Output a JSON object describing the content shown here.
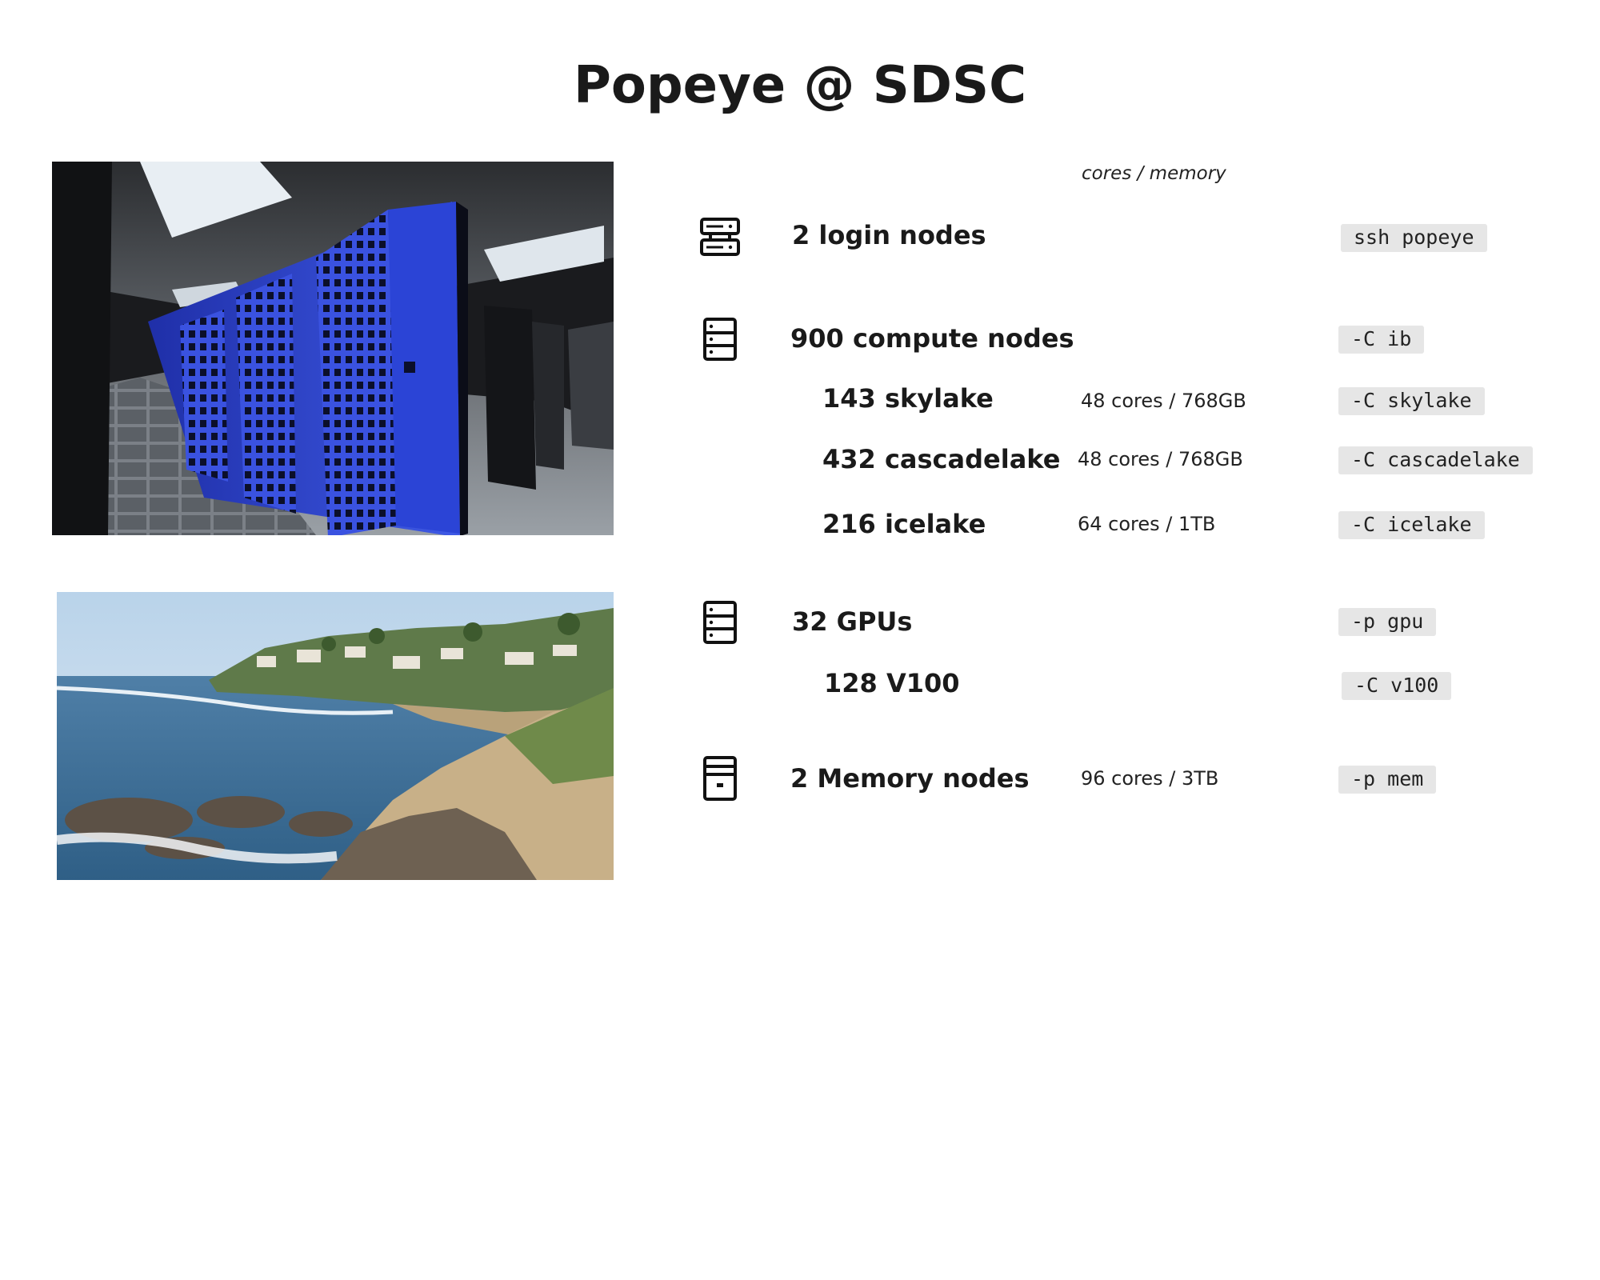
{
  "title": "Popeye @ SDSC",
  "column_header": "cores / memory",
  "images": [
    {
      "name": "datacenter-photo"
    },
    {
      "name": "coastline-photo"
    }
  ],
  "rows": [
    {
      "icon": "login-server-icon",
      "label": "2 login nodes",
      "spec": "",
      "command": "ssh popeye"
    },
    {
      "icon": "compute-server-icon",
      "label": "900 compute nodes",
      "spec": "",
      "command": "-C ib"
    },
    {
      "icon": "",
      "label": "143 skylake",
      "spec": "48 cores / 768GB",
      "command": "-C skylake"
    },
    {
      "icon": "",
      "label": "432 cascadelake",
      "spec": "48 cores / 768GB",
      "command": "-C cascadelake"
    },
    {
      "icon": "",
      "label": "216 icelake",
      "spec": "64 cores / 1TB",
      "command": "-C icelake"
    },
    {
      "icon": "gpu-server-icon",
      "label": "32 GPUs",
      "spec": "",
      "command": "-p gpu"
    },
    {
      "icon": "",
      "label": "128 V100",
      "spec": "",
      "command": "-C v100"
    },
    {
      "icon": "memory-server-icon",
      "label": "2 Memory nodes",
      "spec": "96 cores / 3TB",
      "command": "-p mem"
    }
  ]
}
